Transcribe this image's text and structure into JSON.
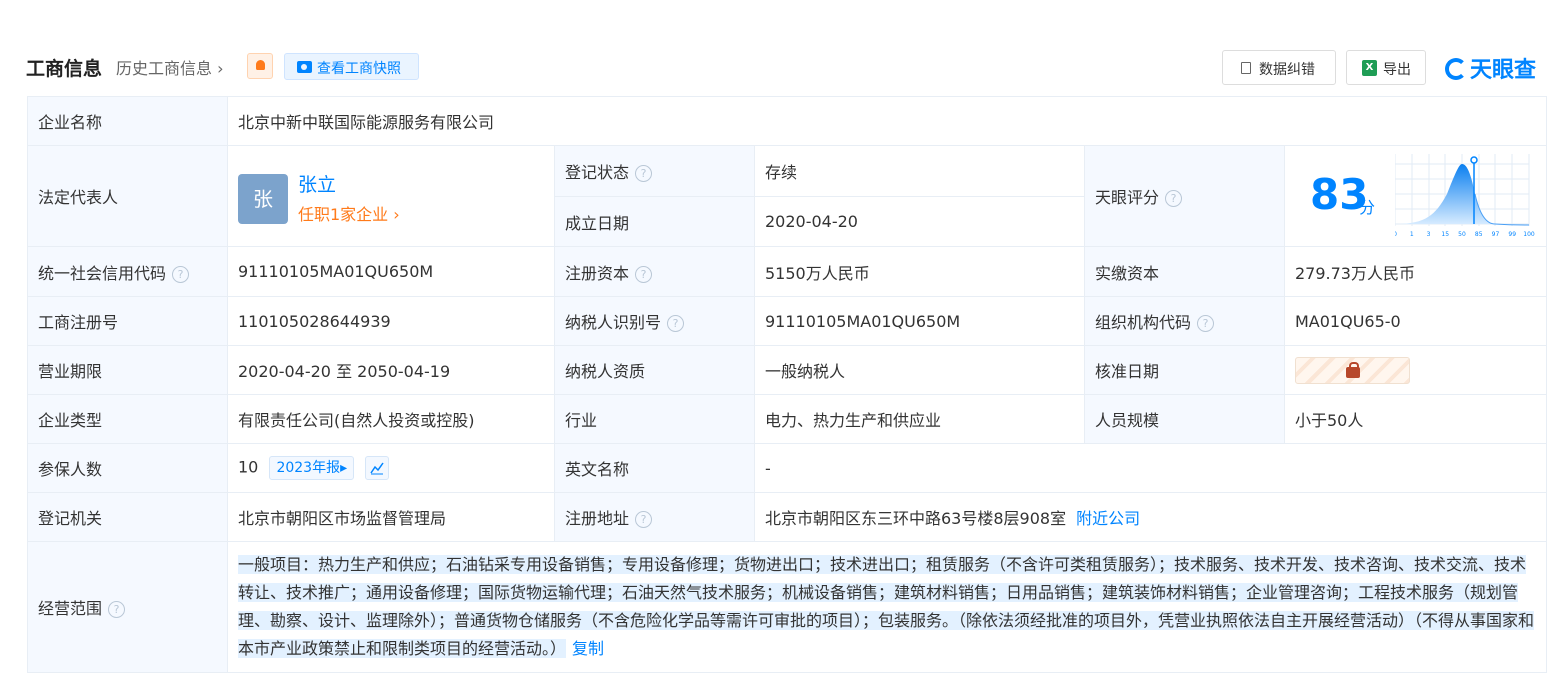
{
  "header": {
    "title": "工商信息",
    "history": "历史工商信息",
    "snapshot_btn": "查看工商快照",
    "correct_btn": "数据纠错",
    "export_btn": "导出",
    "logo_text": "天眼查",
    "accent": "#0084ff"
  },
  "company": {
    "label": "企业名称",
    "value": "北京中新中联国际能源服务有限公司"
  },
  "legal_rep": {
    "label": "法定代表人",
    "avatar_char": "张",
    "name": "张立",
    "jobs": "任职1家企业"
  },
  "reg_status": {
    "label": "登记状态",
    "value": "存续",
    "color": "#2aae5c"
  },
  "found_date": {
    "label": "成立日期",
    "value": "2020-04-20"
  },
  "tianyan_score": {
    "label": "天眼评分",
    "score": "83",
    "unit": "分",
    "axis_ticks": [
      "0",
      "1",
      "3",
      "15",
      "50",
      "85",
      "97",
      "99",
      "100"
    ]
  },
  "rows": {
    "credit_code": {
      "label": "统一社会信用代码",
      "value": "91110105MA01QU650M"
    },
    "reg_capital": {
      "label": "注册资本",
      "value": "5150万人民币"
    },
    "paid_capital": {
      "label": "实缴资本",
      "value": "279.73万人民币"
    },
    "reg_no": {
      "label": "工商注册号",
      "value": "110105028644939"
    },
    "taxpayer_id": {
      "label": "纳税人识别号",
      "value": "91110105MA01QU650M"
    },
    "org_code": {
      "label": "组织机构代码",
      "value": "MA01QU65-0"
    },
    "term": {
      "label": "营业期限",
      "value": "2020-04-20 至 2050-04-19"
    },
    "taxpayer_qual": {
      "label": "纳税人资质",
      "value": "一般纳税人"
    },
    "approve_date": {
      "label": "核准日期"
    },
    "company_type": {
      "label": "企业类型",
      "value": "有限责任公司(自然人投资或控股)"
    },
    "industry": {
      "label": "行业",
      "value": "电力、热力生产和供应业"
    },
    "staff_size": {
      "label": "人员规模",
      "value": "小于50人"
    },
    "insured": {
      "label": "参保人数",
      "value": "10",
      "report": "2023年报"
    },
    "english_name": {
      "label": "英文名称",
      "value": "-"
    },
    "authority": {
      "label": "登记机关",
      "value": "北京市朝阳区市场监督管理局"
    },
    "address": {
      "label": "注册地址",
      "value": "北京市朝阳区东三环中路63号楼8层908室",
      "nearby": "附近公司"
    },
    "scope": {
      "label": "经营范围",
      "value": "一般项目：热力生产和供应；石油钻采专用设备销售；专用设备修理；货物进出口；技术进出口；租赁服务（不含许可类租赁服务）；技术服务、技术开发、技术咨询、技术交流、技术转让、技术推广；通用设备修理；国际货物运输代理；石油天然气技术服务；机械设备销售；建筑材料销售；日用品销售；建筑装饰材料销售；企业管理咨询；工程技术服务（规划管理、勘察、设计、监理除外）；普通货物仓储服务（不含危险化学品等需许可审批的项目）；包装服务。（除依法须经批准的项目外，凭营业执照依法自主开展经营活动）（不得从事国家和本市产业政策禁止和限制类项目的经营活动。）",
      "copy": "复制"
    }
  }
}
